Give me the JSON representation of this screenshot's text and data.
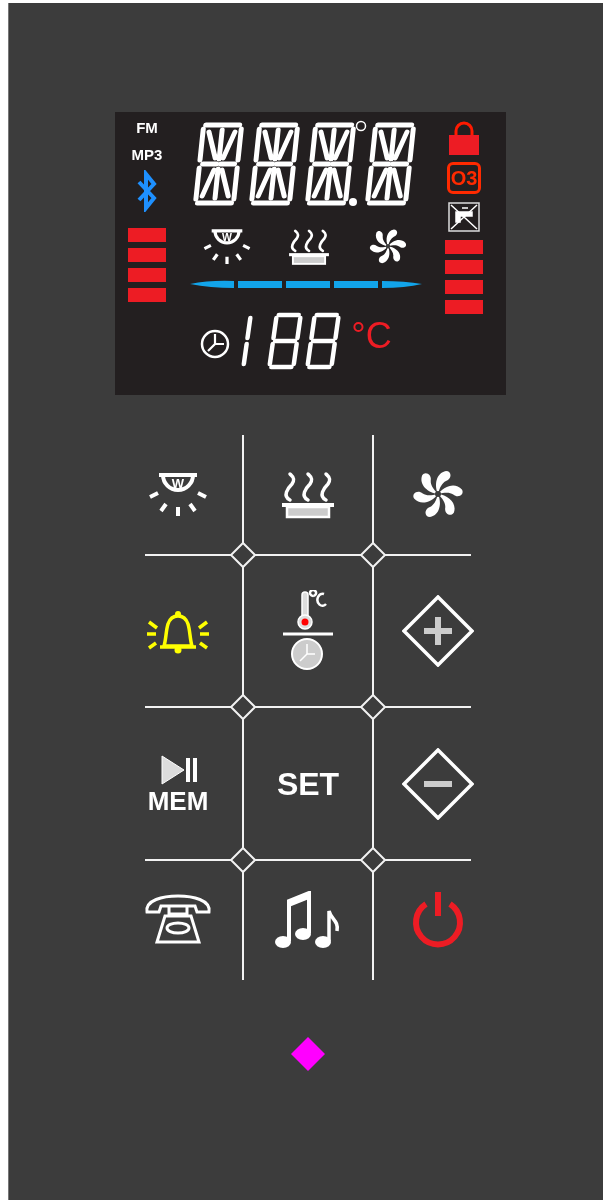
{
  "lcd": {
    "mode_labels": [
      "FM",
      "MP3"
    ],
    "lamp_letter": "W",
    "ozone_label": "O3",
    "temperature_unit": "°C"
  },
  "buttons": [
    {
      "kind": "lamp",
      "color": "#ffffff",
      "label": "W"
    },
    {
      "kind": "steam",
      "color": "#ffffff"
    },
    {
      "kind": "fan",
      "color": "#ffffff"
    },
    {
      "kind": "alarm",
      "color": "#ffff00"
    },
    {
      "kind": "temp-timer",
      "color": "#ffffff"
    },
    {
      "kind": "plus",
      "color": "#ffffff"
    },
    {
      "kind": "play-mem",
      "color": "#ffffff",
      "label": "MEM"
    },
    {
      "kind": "set",
      "color": "#ffffff",
      "label": "SET"
    },
    {
      "kind": "minus",
      "color": "#ffffff"
    },
    {
      "kind": "phone",
      "color": "#ffffff"
    },
    {
      "kind": "music",
      "color": "#ffffff"
    },
    {
      "kind": "power",
      "color": "#ed1c24"
    }
  ]
}
